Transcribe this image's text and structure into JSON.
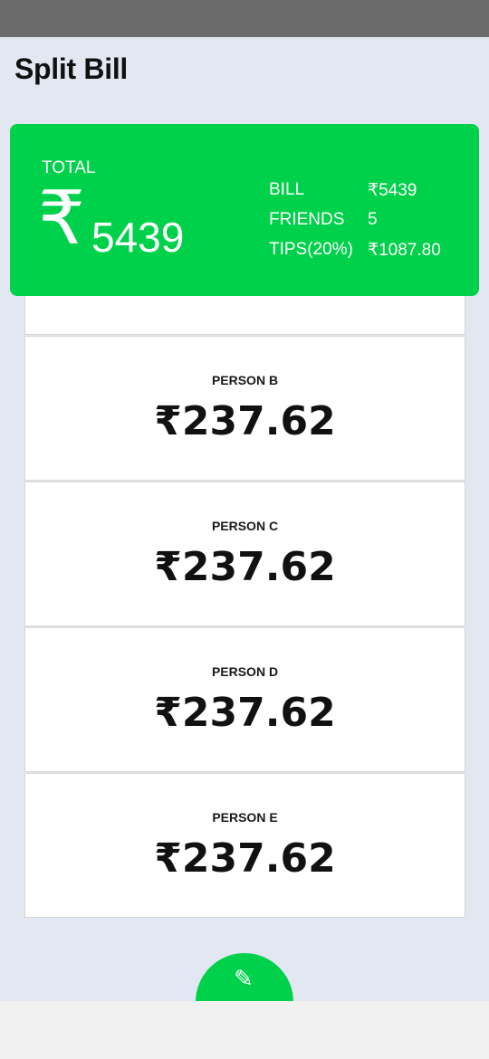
{
  "app": {
    "title": "Split Bill"
  },
  "total": {
    "label": "TOTAL",
    "currency_symbol": "₹",
    "amount": "5439"
  },
  "summary": [
    {
      "label": "BILL",
      "value": "₹5439"
    },
    {
      "label": "FRIENDS",
      "value": "5"
    },
    {
      "label": "TIPS(20%)",
      "value": "₹1087.80"
    }
  ],
  "people": [
    {
      "name": "PERSON B",
      "amount": "₹237.62"
    },
    {
      "name": "PERSON C",
      "amount": "₹237.62"
    },
    {
      "name": "PERSON D",
      "amount": "₹237.62"
    },
    {
      "name": "PERSON E",
      "amount": "₹237.62"
    }
  ],
  "fab": {
    "icon": "pencil-icon",
    "icon_glyph": "✎"
  },
  "colors": {
    "accent": "#00d14a",
    "background": "#e3e7f1",
    "status_bar": "#6b6b6b"
  }
}
